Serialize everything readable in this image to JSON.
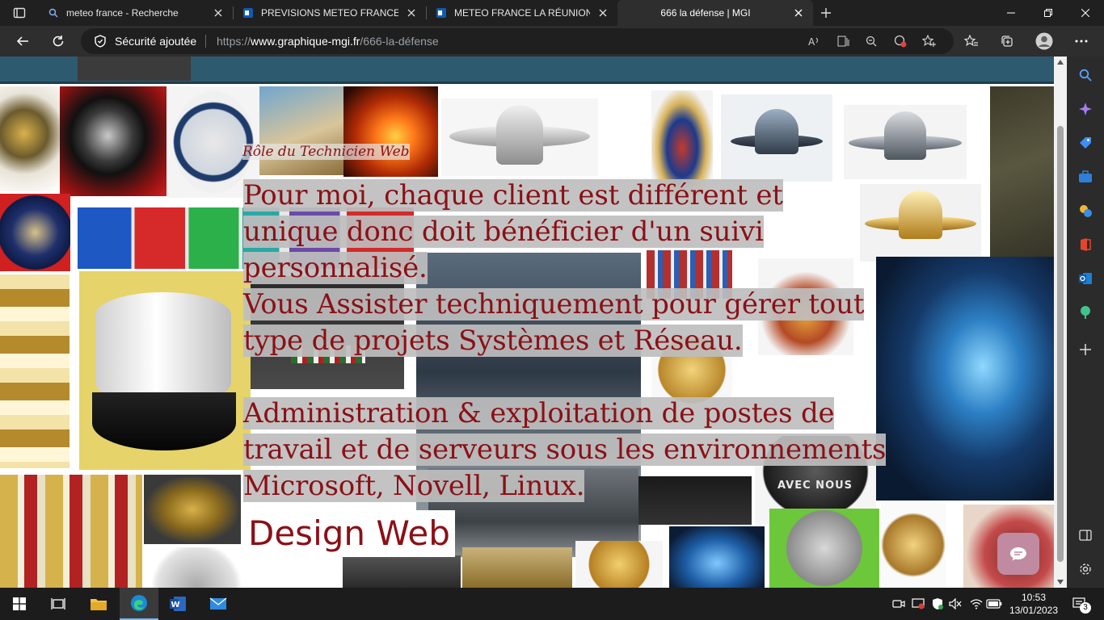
{
  "browser": {
    "tabs": [
      {
        "title": "meteo france - Recherche",
        "icon": "search-icon",
        "active": false
      },
      {
        "title": "PREVISIONS METEO FRANCE - Site",
        "icon": "outlook-icon",
        "active": false
      },
      {
        "title": "METEO FRANCE LA RÉUNION par",
        "icon": "outlook-icon",
        "active": false
      },
      {
        "title": "666 la défense | MGI",
        "icon": "page-icon",
        "active": true
      }
    ],
    "security_label": "Sécurité ajoutée",
    "url_prefix": "https://",
    "url_domain": "www.graphique-mgi.fr",
    "url_path": "/666-la-défense"
  },
  "page": {
    "role_label": "Rôle du Technicien Web",
    "paragraphs": [
      "Pour moi, chaque client est différent et unique donc doit bénéficier d'un suivi personnalisé.",
      "Vous Assister techniquement pour gérer tout type de projets Systèmes et Réseau.",
      "Administration & exploitation de postes de travail et de serveurs sous les environnements Microsoft, Novell, Linux."
    ],
    "section_heading": "Design Web",
    "collage_caption": "AVEC NOUS"
  },
  "taskbar": {
    "time": "10:53",
    "date": "13/01/2023",
    "notification_count": "3"
  },
  "colors": {
    "text_accent": "#8b1016",
    "highlight_bg": "#bebebe",
    "banner": "#2d5a6e"
  }
}
